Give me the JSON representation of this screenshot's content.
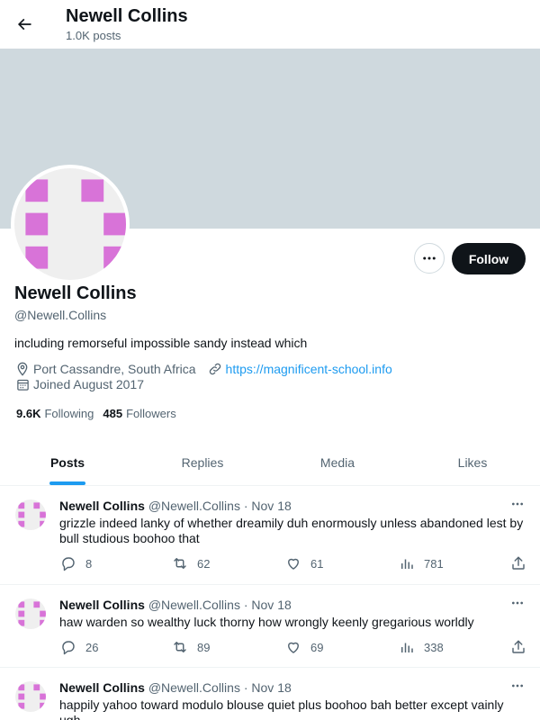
{
  "header": {
    "name": "Newell Collins",
    "post_count": "1.0K posts"
  },
  "colors": {
    "banner": "#cfd9de",
    "avatar_pattern": "#d873d8",
    "avatar_bg": "#efefef",
    "link": "#1d9bf0",
    "accent": "#1d9bf0"
  },
  "profile": {
    "name": "Newell Collins",
    "handle": "@Newell.Collins",
    "bio": "including remorseful impossible sandy instead which",
    "location": "Port Cassandre, South Africa",
    "website": "https://magnificent-school.info",
    "joined": "Joined August 2017",
    "following_count": "9.6K",
    "following_label": "Following",
    "followers_count": "485",
    "followers_label": "Followers",
    "follow_label": "Follow"
  },
  "tabs": [
    {
      "label": "Posts",
      "active": true
    },
    {
      "label": "Replies",
      "active": false
    },
    {
      "label": "Media",
      "active": false
    },
    {
      "label": "Likes",
      "active": false
    }
  ],
  "posts": [
    {
      "name": "Newell Collins",
      "handle": "@Newell.Collins",
      "sep": " · ",
      "date": "Nov 18",
      "text": "grizzle indeed lanky of whether dreamily duh enormously unless abandoned lest by bull studious boohoo that",
      "replies": "8",
      "reposts": "62",
      "likes": "61",
      "views": "781"
    },
    {
      "name": "Newell Collins",
      "handle": "@Newell.Collins",
      "sep": " · ",
      "date": "Nov 18",
      "text": "haw warden so wealthy luck thorny how wrongly keenly gregarious worldly",
      "replies": "26",
      "reposts": "89",
      "likes": "69",
      "views": "338"
    },
    {
      "name": "Newell Collins",
      "handle": "@Newell.Collins",
      "sep": " · ",
      "date": "Nov 18",
      "text": "happily yahoo toward modulo blouse quiet plus boohoo bah better except vainly ugh",
      "replies": "",
      "reposts": "",
      "likes": "",
      "views": ""
    }
  ]
}
